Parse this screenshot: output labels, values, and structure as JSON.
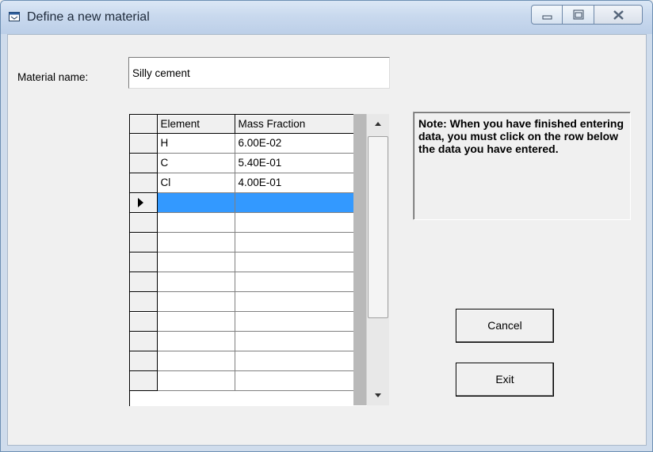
{
  "window": {
    "title": "Define a new material",
    "icons": {
      "app": "window-app-icon",
      "minimize": "minimize-icon",
      "maximize": "maximize-icon",
      "close": "close-icon"
    }
  },
  "form": {
    "material_name_label": "Material name:",
    "material_name_value": "Silly cement"
  },
  "grid": {
    "columns": [
      "Element",
      "Mass Fraction"
    ],
    "rows": [
      {
        "element": "H",
        "mass_fraction": "6.00E-02"
      },
      {
        "element": "C",
        "mass_fraction": "5.40E-01"
      },
      {
        "element": "Cl",
        "mass_fraction": "4.00E-01"
      }
    ],
    "active_row_index": 3,
    "selection_color": "#3399ff"
  },
  "note": "Note: When you have finished entering data, you must click on the row below the data you have entered.",
  "buttons": {
    "cancel": "Cancel",
    "exit": "Exit"
  }
}
